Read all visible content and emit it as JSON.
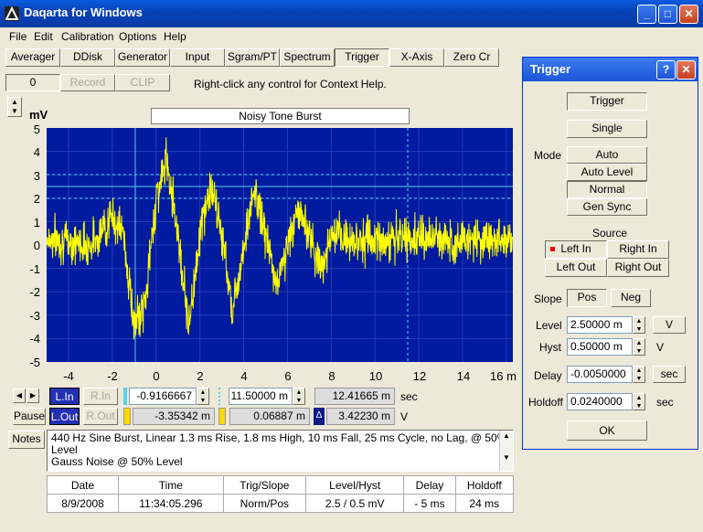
{
  "window": {
    "title": "Daqarta for Windows"
  },
  "menu": [
    "File",
    "Edit",
    "Calibration",
    "Options",
    "Help"
  ],
  "toolbar": {
    "tabs": [
      "Averager",
      "DDisk",
      "Generator",
      "Input",
      "Sgram/PT",
      "Spectrum",
      "Trigger",
      "X-Axis",
      "Zero Cr"
    ],
    "counter": "0",
    "record": "Record",
    "clip": "CLIP",
    "help_text": "Right-click any control for Context Help."
  },
  "plot": {
    "y_unit": "mV",
    "title": "Noisy Tone Burst",
    "y_ticks": [
      "5",
      "4",
      "3",
      "2",
      "1",
      "0",
      "-1",
      "-2",
      "-3",
      "-4",
      "-5"
    ],
    "x_ticks": [
      "-4",
      "-2",
      "0",
      "2",
      "4",
      "6",
      "8",
      "10",
      "12",
      "14",
      "16 m"
    ],
    "colors": {
      "background": "#001aa0",
      "trace": "#ffff00",
      "cursor": "#5ad0f0"
    }
  },
  "chart_data": {
    "type": "line",
    "title": "Noisy Tone Burst",
    "xlabel": "",
    "ylabel": "mV",
    "xlim": [
      -5,
      16.3
    ],
    "ylim": [
      -5,
      5
    ],
    "description_points": {
      "x": [
        -5,
        -3,
        -2,
        -1.5,
        -1,
        -0.5,
        0,
        0.5,
        1,
        1.5,
        2,
        2.5,
        3,
        3.5,
        4,
        4.5,
        5,
        5.5,
        6,
        6.5,
        7,
        7.5,
        8,
        10,
        12,
        14,
        16
      ],
      "y": [
        0.3,
        0,
        1.2,
        0.5,
        -3.5,
        -2.5,
        2,
        3.7,
        0.5,
        -3.5,
        0.5,
        2.5,
        0.5,
        -2.8,
        0,
        2.3,
        0.5,
        -1.8,
        0,
        1.5,
        0.5,
        -1,
        0.3,
        0.2,
        0.3,
        0.2,
        0.3
      ]
    },
    "trigger_level": 2.5,
    "cursor_x": -0.9166667,
    "cursor2_x": 11.5
  },
  "controls": {
    "lin": "L.In",
    "rin": "R.In",
    "pause": "Pause",
    "lout": "L.Out",
    "rout": "R.Out",
    "x1": "-0.9166667 m",
    "x2": "11.50000 m",
    "dx": "12.41665 m",
    "x_unit": "sec",
    "y1": "-3.35342 m",
    "y2": "0.06887 m",
    "dy": "3.42230 m",
    "y_unit": "V",
    "delta": "Δ"
  },
  "notes": {
    "label": "Notes",
    "line1": "440 Hz Sine Burst, Linear 1.3 ms Rise, 1.8 ms High, 10 ms Fall, 25 ms Cycle, no Lag, @ 50% Level",
    "line2": "Gauss Noise @ 50% Level"
  },
  "info_table": {
    "headers": [
      "Date",
      "Time",
      "Trig/Slope",
      "Level/Hyst",
      "Delay",
      "Holdoff"
    ],
    "values": [
      "8/9/2008",
      "11:34:05.296",
      "Norm/Pos",
      "2.5 / 0.5 mV",
      "- 5 ms",
      "24 ms"
    ]
  },
  "trigger_panel": {
    "title": "Trigger",
    "trigger_btn": "Trigger",
    "single_btn": "Single",
    "mode_label": "Mode",
    "modes": [
      "Auto",
      "Auto Level",
      "Normal",
      "Gen Sync"
    ],
    "source_label": "Source",
    "sources": [
      "Left In",
      "Right In",
      "Left Out",
      "Right Out"
    ],
    "slope_label": "Slope",
    "pos": "Pos",
    "neg": "Neg",
    "level_label": "Level",
    "level_value": "2.50000 m",
    "level_unit": "V",
    "hyst_label": "Hyst",
    "hyst_value": "0.50000 m",
    "hyst_unit": "V",
    "delay_label": "Delay",
    "delay_value": "-0.0050000",
    "delay_unit": "sec",
    "holdoff_label": "Holdoff",
    "holdoff_value": "0.0240000",
    "holdoff_unit": "sec",
    "ok": "OK"
  }
}
